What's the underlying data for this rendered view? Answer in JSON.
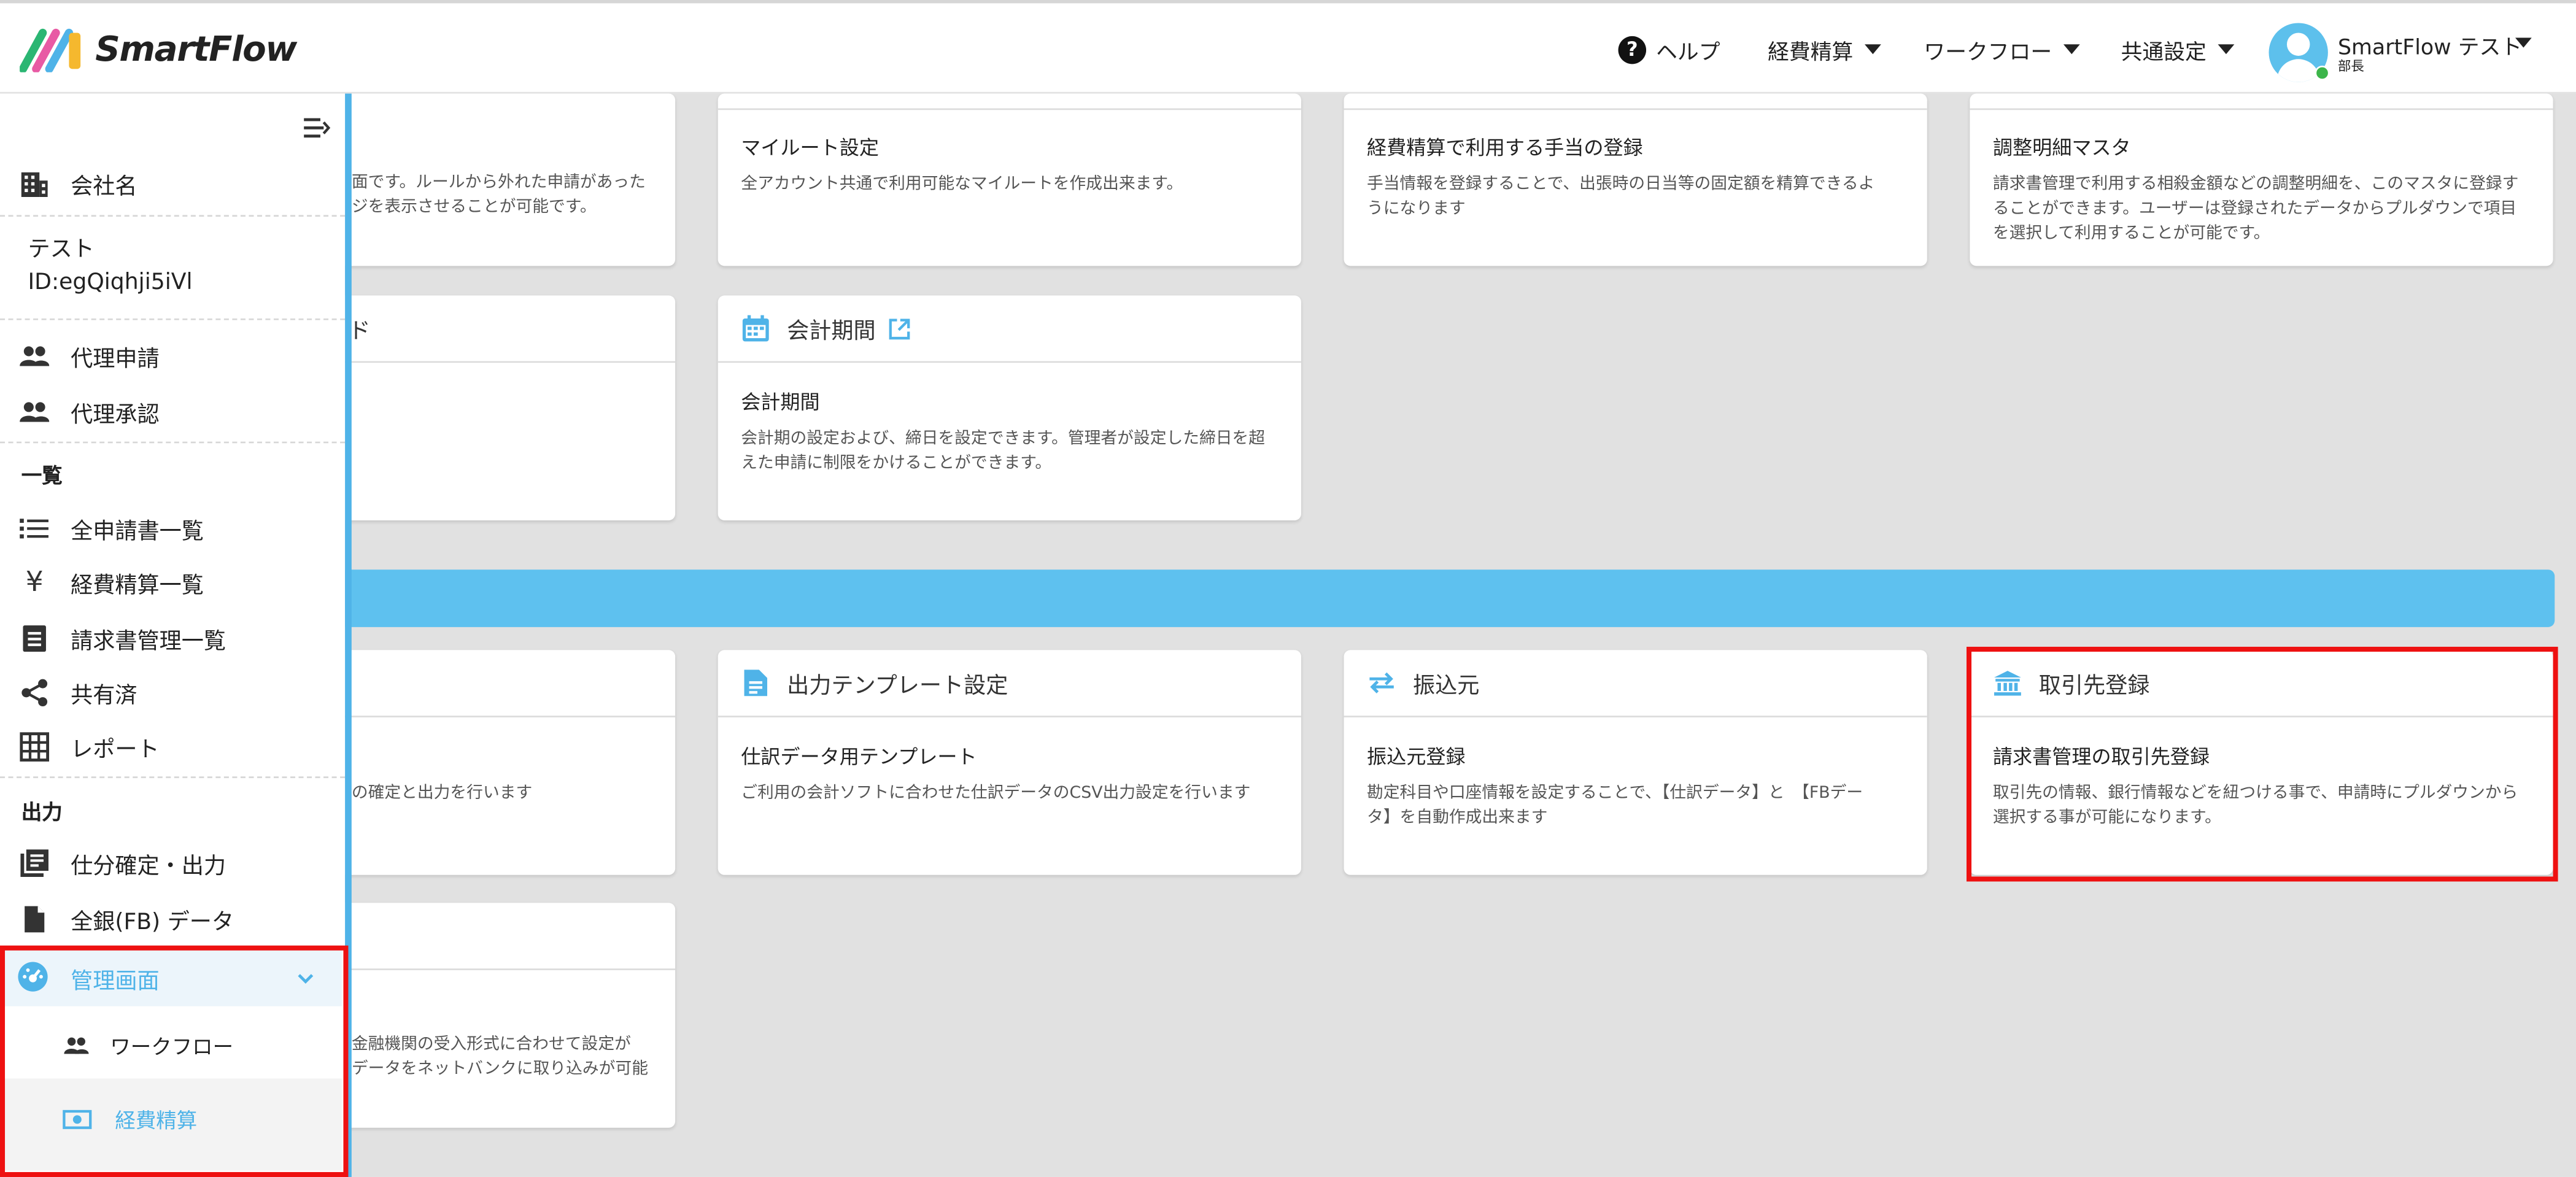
{
  "header": {
    "logo_text": "SmartFlow",
    "help_label": "ヘルプ",
    "nav": [
      {
        "label": "経費精算"
      },
      {
        "label": "ワークフロー"
      },
      {
        "label": "共通設定"
      }
    ],
    "user": {
      "name": "SmartFlow テスト",
      "role": "部長"
    }
  },
  "sidebar": {
    "company_label": "会社名",
    "company_name": "テスト",
    "company_id": "ID:egQiqhji5iVl",
    "items_top": [
      {
        "label": "代理申請",
        "icon": "people-icon"
      },
      {
        "label": "代理承認",
        "icon": "people-icon"
      }
    ],
    "section_list": "一覧",
    "items_list": [
      {
        "label": "全申請書一覧",
        "icon": "list-icon"
      },
      {
        "label": "経費精算一覧",
        "icon": "yen-icon"
      },
      {
        "label": "請求書管理一覧",
        "icon": "document-icon"
      },
      {
        "label": "共有済",
        "icon": "share-icon"
      },
      {
        "label": "レポート",
        "icon": "table-icon"
      }
    ],
    "section_output": "出力",
    "items_output": [
      {
        "label": "仕分確定・出力",
        "icon": "book-icon"
      },
      {
        "label": "全銀(FB) データ",
        "icon": "file-icon"
      }
    ],
    "management": {
      "label": "管理画面",
      "children": [
        {
          "label": "ワークフロー",
          "icon": "people-icon"
        },
        {
          "label": "経費精算",
          "icon": "money-icon"
        }
      ]
    }
  },
  "cards_top_row": [
    {
      "sub": "",
      "desc": "面です。ルールから外れた申請があった\nジを表示させることが可能です。"
    },
    {
      "sub": "マイルート設定",
      "desc": "全アカウント共通で利用可能なマイルートを作成出来ます。"
    },
    {
      "sub": "経費精算で利用する手当の登録",
      "desc": "手当情報を登録することで、出張時の日当等の固定額を精算できるよ\nうになります"
    },
    {
      "sub": "調整明細マスタ",
      "desc": "請求書管理で利用する相殺金額などの調整明細を、このマスタに登録す\nることができます。ユーザーは登録されたデータからプルダウンで項目\nを選択して利用することが可能です。"
    }
  ],
  "card_partial_2": {
    "title_fragment": "ド"
  },
  "card_fiscal": {
    "title": "会計期間",
    "sub": "会計期間",
    "desc": "会計期の設定および、締日を設定できます。管理者が設定した締日を超\nえた申請に制限をかけることができます。"
  },
  "card_partial_output": {
    "desc": "の確定と出力を行います"
  },
  "card_template": {
    "title": "出力テンプレート設定",
    "sub": "仕訳データ用テンプレート",
    "desc": "ご利用の会計ソフトに合わせた仕訳データのCSV出力設定を行います"
  },
  "card_transfer": {
    "title": "振込元",
    "sub": "振込元登録",
    "desc": "勘定科目や口座情報を設定することで、【仕訳データ】と　【FBデー\nタ】を自動作成出来ます"
  },
  "card_supplier": {
    "title": "取引先登録",
    "sub": "請求書管理の取引先登録",
    "desc": "取引先の情報、銀行情報などを紐つける事で、申請時にプルダウンから\n選択する事が可能になります。"
  },
  "card_partial_fb": {
    "desc": "金融機関の受入形式に合わせて設定が\nデータをネットバンクに取り込みが可能"
  },
  "colors": {
    "accent": "#5ec1ef",
    "highlight": "#ee1111",
    "background": "#e1e1e1"
  }
}
